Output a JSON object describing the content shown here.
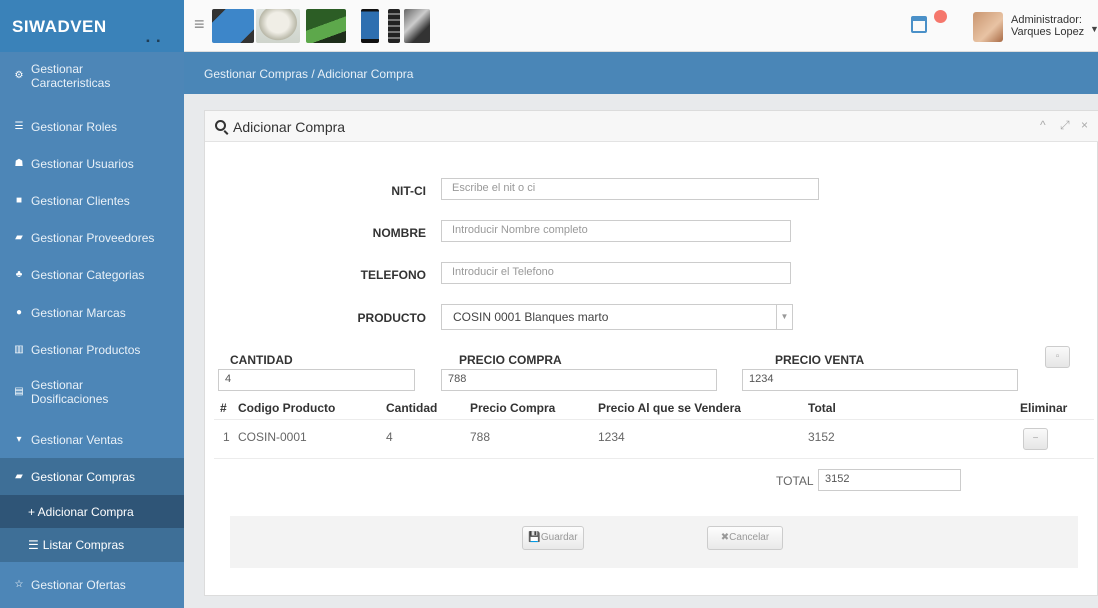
{
  "brand": {
    "name": "SIWADVEN",
    "dots": "▪ ▪"
  },
  "header": {
    "menu_icon": "hamburger-icon",
    "user_line1": "Administrador:",
    "user_line2": "Varques Lopez",
    "colors": {
      "brand_bg": "#3a82b9",
      "sidebar_bg": "#4d86b7",
      "notification": "#f5776c"
    }
  },
  "sidebar": {
    "items": [
      {
        "label": "Gestionar Caracteristicas",
        "icon": "gears-icon"
      },
      {
        "label": "Gestionar Roles",
        "icon": "list-icon"
      },
      {
        "label": "Gestionar Usuarios",
        "icon": "users-icon"
      },
      {
        "label": "Gestionar Clientes",
        "icon": "briefcase-icon"
      },
      {
        "label": "Gestionar Proveedores",
        "icon": "truck-icon"
      },
      {
        "label": "Gestionar Categorias",
        "icon": "sitemap-icon"
      },
      {
        "label": "Gestionar Marcas",
        "icon": "circle-icon"
      },
      {
        "label": "Gestionar Productos",
        "icon": "barcode-icon"
      },
      {
        "label": "Gestionar Dosificaciones",
        "icon": "document-icon"
      },
      {
        "label": "Gestionar Ventas",
        "icon": "cart-icon"
      },
      {
        "label": "Gestionar Compras",
        "icon": "truck-icon"
      },
      {
        "label": "+ Adicionar Compra",
        "icon": "plus-icon"
      },
      {
        "label": "Listar Compras",
        "icon": "list-icon"
      },
      {
        "label": "Gestionar Ofertas",
        "icon": "star-icon"
      }
    ]
  },
  "breadcrumb": {
    "text": "Gestionar Compras / Adicionar Compra"
  },
  "panel": {
    "title": "Adicionar Compra",
    "controls": [
      "^",
      "⤢",
      "×"
    ]
  },
  "form": {
    "nit_label": "NIT-CI",
    "nit_placeholder": "Escribe el nit o ci",
    "nombre_label": "NOMBRE",
    "nombre_placeholder": "Introducir Nombre completo",
    "telefono_label": "TELEFONO",
    "telefono_placeholder": "Introducir el Telefono",
    "producto_label": "PRODUCTO",
    "producto_value": "COSIN 0001 Blanques marto",
    "cantidad_label": "CANTIDAD",
    "cantidad_value": "4",
    "precio_compra_label": "PRECIO COMPRA",
    "precio_compra_value": "788",
    "precio_venta_label": "PRECIO VENTA",
    "precio_venta_value": "1234",
    "add_button": "▫"
  },
  "table": {
    "headers": [
      "#",
      "Codigo Producto",
      "Cantidad",
      "Precio Compra",
      "Precio Al que se Vendera",
      "Total",
      "Eliminar"
    ],
    "rows": [
      {
        "n": "1",
        "codigo": "COSIN-0001",
        "cantidad": "4",
        "precio_compra": "788",
        "precio_venta": "1234",
        "total": "3152",
        "eliminar": "−"
      }
    ],
    "total_label": "TOTAL",
    "total_value": "3152"
  },
  "actions": {
    "save": "💾Guardar",
    "cancel": "✖Cancelar"
  }
}
